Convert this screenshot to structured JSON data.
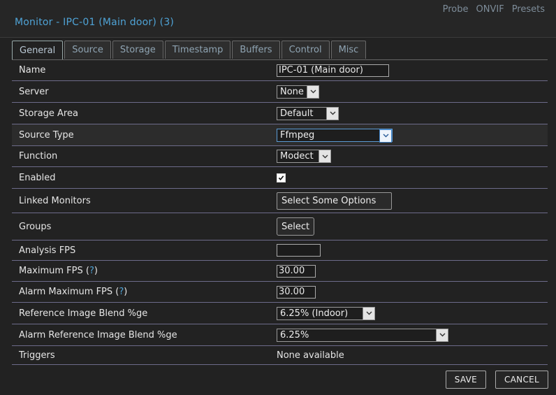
{
  "header": {
    "title": "Monitor - IPC-01 (Main door) (3)",
    "links": [
      "Probe",
      "ONVIF",
      "Presets"
    ]
  },
  "tabs": [
    {
      "label": "General",
      "active": true
    },
    {
      "label": "Source"
    },
    {
      "label": "Storage"
    },
    {
      "label": "Timestamp"
    },
    {
      "label": "Buffers"
    },
    {
      "label": "Control"
    },
    {
      "label": "Misc"
    }
  ],
  "fields": {
    "name": {
      "label": "Name",
      "value": "IPC-01 (Main door)"
    },
    "server": {
      "label": "Server",
      "value": "None"
    },
    "storage_area": {
      "label": "Storage Area",
      "value": "Default"
    },
    "source_type": {
      "label": "Source Type",
      "value": "Ffmpeg"
    },
    "function": {
      "label": "Function",
      "value": "Modect"
    },
    "enabled": {
      "label": "Enabled",
      "checked": true
    },
    "linked_monitors": {
      "label": "Linked Monitors",
      "button": "Select Some Options"
    },
    "groups": {
      "label": "Groups",
      "button": "Select"
    },
    "analysis_fps": {
      "label": "Analysis FPS",
      "value": ""
    },
    "maximum_fps": {
      "label": "Maximum FPS (",
      "help": "?",
      "close": ")",
      "value": "30.00"
    },
    "alarm_maximum_fps": {
      "label": "Alarm Maximum FPS (",
      "help": "?",
      "close": ")",
      "value": "30.00"
    },
    "ref_blend": {
      "label": "Reference Image Blend %ge",
      "value": "6.25% (Indoor)"
    },
    "alarm_ref_blend": {
      "label": "Alarm Reference Image Blend %ge",
      "value": "6.25%"
    },
    "triggers": {
      "label": "Triggers",
      "value": "None available"
    }
  },
  "footer": {
    "save_label": "SAVE",
    "cancel_label": "CANCEL"
  },
  "colors": {
    "accent": "#4fa3d6",
    "background": "#222222",
    "row_divider": "#6d6b8a"
  }
}
